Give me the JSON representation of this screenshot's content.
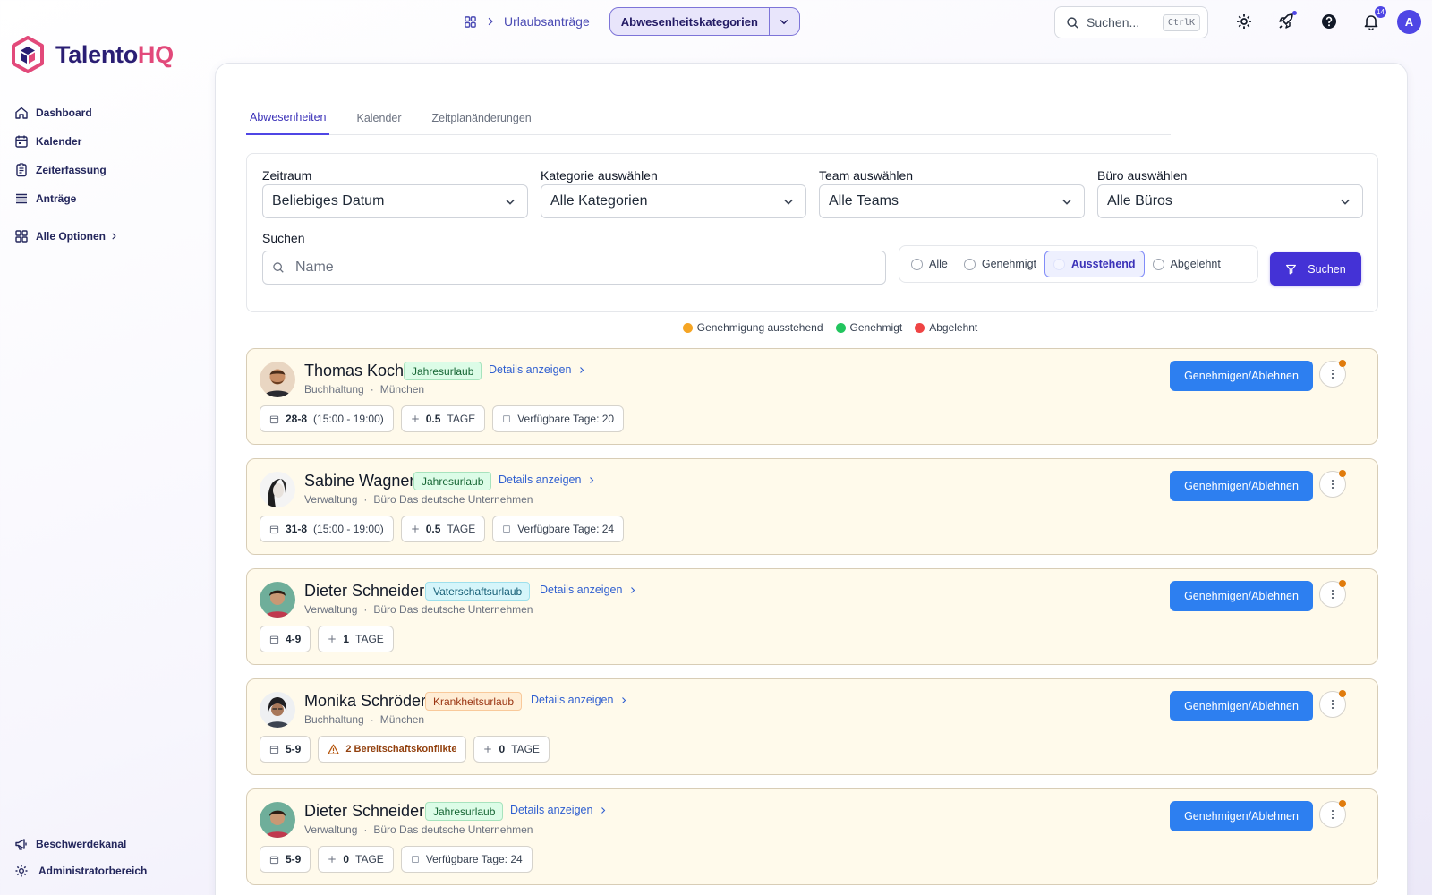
{
  "brand": {
    "part1": "Talento",
    "part2": "HQ"
  },
  "sidebar": {
    "items": [
      {
        "label": "Dashboard"
      },
      {
        "label": "Kalender"
      },
      {
        "label": "Zeiterfassung"
      },
      {
        "label": "Anträge"
      },
      {
        "label": "Alle Optionen"
      }
    ],
    "bottom": [
      {
        "label": "Beschwerdekanal"
      },
      {
        "label": "Administratorbereich"
      }
    ]
  },
  "topbar": {
    "breadcrumb": "Urlaubsanträge",
    "category_button": "Abwesenheitskategorien",
    "search_placeholder": "Suchen...",
    "search_shortcut": "CtrlK",
    "notification_count": "14",
    "avatar_initial": "A"
  },
  "tabs": [
    {
      "label": "Abwesenheiten",
      "active": true
    },
    {
      "label": "Kalender"
    },
    {
      "label": "Zeitplanänderungen"
    }
  ],
  "filters": {
    "period": {
      "label": "Zeitraum",
      "value": "Beliebiges Datum"
    },
    "category": {
      "label": "Kategorie auswählen",
      "value": "Alle Kategorien"
    },
    "team": {
      "label": "Team auswählen",
      "value": "Alle Teams"
    },
    "office": {
      "label": "Büro auswählen",
      "value": "Alle Büros"
    },
    "search": {
      "label": "Suchen",
      "placeholder": "Name"
    },
    "status_options": [
      {
        "label": "Alle"
      },
      {
        "label": "Genehmigt"
      },
      {
        "label": "Ausstehend",
        "selected": true
      },
      {
        "label": "Abgelehnt"
      }
    ],
    "search_button": "Suchen"
  },
  "legend": [
    {
      "label": "Genehmigung ausstehend",
      "color": "#f5a524"
    },
    {
      "label": "Genehmigt",
      "color": "#22c55e"
    },
    {
      "label": "Abgelehnt",
      "color": "#ef4444"
    }
  ],
  "colors": {
    "accent": "#4432d6",
    "approve": "#2d7ff0",
    "pending_row": "#fffaeb",
    "pending_dot": "#e07b0c"
  },
  "requests": [
    {
      "name": "Thomas Koch",
      "category": "Jahresurlaub",
      "details": "Details anzeigen",
      "department": "Buchhaltung",
      "office": "München",
      "date": "28-8",
      "time": "(15:00 - 19:00)",
      "days_value": "0.5",
      "days_unit": "TAGE",
      "available": "Verfügbare Tage: 20",
      "action": "Genehmigen/Ablehnen"
    },
    {
      "name": "Sabine Wagner",
      "category": "Jahresurlaub",
      "details": "Details anzeigen",
      "department": "Verwaltung",
      "office": "Büro Das deutsche Unternehmen",
      "date": "31-8",
      "time": "(15:00 - 19:00)",
      "days_value": "0.5",
      "days_unit": "TAGE",
      "available": "Verfügbare Tage: 24",
      "action": "Genehmigen/Ablehnen"
    },
    {
      "name": "Dieter Schneider",
      "category": "Vaterschaftsurlaub",
      "details": "Details anzeigen",
      "department": "Verwaltung",
      "office": "Büro Das deutsche Unternehmen",
      "date": "4-9",
      "days_value": "1",
      "days_unit": "TAGE",
      "action": "Genehmigen/Ablehnen"
    },
    {
      "name": "Monika Schröder",
      "category": "Krankheitsurlaub",
      "details": "Details anzeigen",
      "department": "Buchhaltung",
      "office": "München",
      "date": "5-9",
      "conflict": "2 Bereitschaftskonflikte",
      "days_value": "0",
      "days_unit": "TAGE",
      "action": "Genehmigen/Ablehnen"
    },
    {
      "name": "Dieter Schneider",
      "category": "Jahresurlaub",
      "details": "Details anzeigen",
      "department": "Verwaltung",
      "office": "Büro Das deutsche Unternehmen",
      "date": "5-9",
      "days_value": "0",
      "days_unit": "TAGE",
      "available": "Verfügbare Tage: 24",
      "action": "Genehmigen/Ablehnen"
    }
  ]
}
